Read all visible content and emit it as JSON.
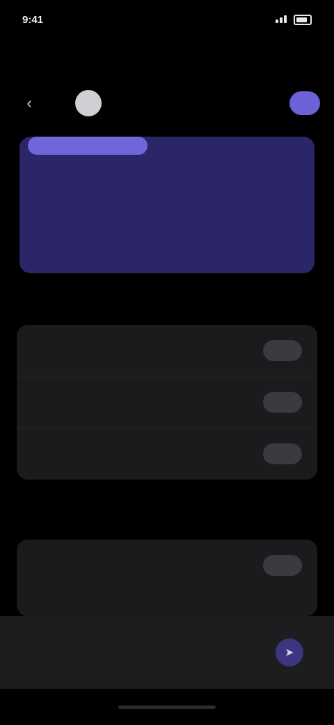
{
  "status_bar": {
    "time": "9:41"
  },
  "header": {
    "subtitle": "",
    "label": "",
    "primary_button": ""
  },
  "hero": {
    "pill": "",
    "line1": "",
    "line2": ""
  },
  "sections": [
    {
      "label": "",
      "rows": [
        {
          "text": "",
          "action": ""
        },
        {
          "text": "",
          "action": ""
        },
        {
          "text": "",
          "action": ""
        }
      ]
    },
    {
      "label": "",
      "rows": [
        {
          "text": "",
          "action": ""
        }
      ]
    }
  ],
  "composer": {
    "placeholder": ""
  },
  "colors": {
    "background": "#000000",
    "accent": "#6a62d6",
    "hero_card": "#2a2668",
    "card": "#1b1b1e",
    "row_button": "#3a3a3f"
  },
  "icons": {
    "back": "chevron-left-icon",
    "send": "send-icon"
  }
}
